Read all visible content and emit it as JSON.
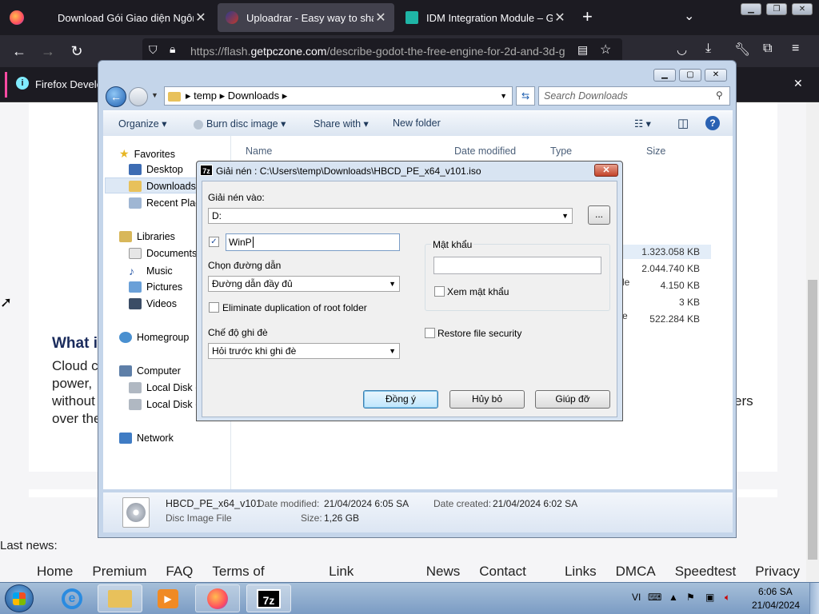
{
  "browser": {
    "tabs": [
      {
        "title": "Download Gói Giao diện Ngôn ngữ"
      },
      {
        "title": "Uploadrar - Easy way to share y"
      },
      {
        "title": "IDM Integration Module – Get th"
      }
    ],
    "new_tab": "+",
    "url_prefix": "https://flash.",
    "url_domain": "getpczone.com",
    "url_path": "/describe-godot-the-free-engine-for-2d-and-3d-g",
    "notification": "Firefox Develop"
  },
  "page": {
    "heading": "What i",
    "lines": [
      "Cloud c",
      "power,",
      "without",
      "over the"
    ],
    "right_fragment": "ers",
    "last_news": "Last news:",
    "footer_links": [
      "Home",
      "Premium",
      "FAQ",
      "Terms of service",
      "Link Checker",
      "News",
      "Contact Us",
      "Links",
      "DMCA",
      "Speedtest",
      "Privacy"
    ]
  },
  "explorer": {
    "breadcrumb": [
      "temp",
      "Downloads"
    ],
    "search_placeholder": "Search Downloads",
    "toolbar": {
      "organize": "Organize",
      "burn": "Burn disc image",
      "share": "Share with",
      "new_folder": "New folder"
    },
    "nav": {
      "favorites": "Favorites",
      "desktop": "Desktop",
      "downloads": "Downloads",
      "recent": "Recent Places",
      "libraries": "Libraries",
      "documents": "Documents",
      "music": "Music",
      "pictures": "Pictures",
      "videos": "Videos",
      "homegroup": "Homegroup",
      "computer": "Computer",
      "local_c": "Local Disk (C:)",
      "local_d": "Local Disk (D:)",
      "network": "Network"
    },
    "columns": {
      "name": "Name",
      "date": "Date modified",
      "type": "Type",
      "size": "Size"
    },
    "sizes": [
      "1.323.058 KB",
      "2.044.740 KB",
      "4.150 KB",
      "3 KB",
      "522.284 KB"
    ],
    "type_fragments": [
      "le",
      "e"
    ],
    "details": {
      "filename": "HBCD_PE_x64_v101",
      "filetype": "Disc Image File",
      "date_modified_label": "Date modified:",
      "date_modified": "21/04/2024 6:05 SA",
      "date_created_label": "Date created:",
      "date_created": "21/04/2024 6:02 SA",
      "size_label": "Size:",
      "size": "1,26 GB"
    }
  },
  "dialog": {
    "title": "Giải nén : C:\\Users\\temp\\Downloads\\HBCD_PE_x64_v101.iso",
    "icon_label": "7z",
    "extract_to_label": "Giải nén vào:",
    "extract_to_value": "D:",
    "browse": "...",
    "subfolder_value": "WinP",
    "path_mode_label": "Chọn đường dẫn",
    "path_mode_value": "Đường dẫn đầy đủ",
    "eliminate_label": "Eliminate duplication of root folder",
    "overwrite_label": "Chế độ ghi đè",
    "overwrite_value": "Hỏi trước khi ghi đè",
    "password_label": "Mật khẩu",
    "show_password_label": "Xem mật khẩu",
    "restore_label": "Restore file security",
    "ok": "Đồng ý",
    "cancel": "Hủy bỏ",
    "help": "Giúp đỡ"
  },
  "taskbar": {
    "lang": "VI",
    "time": "6:06 SA",
    "date": "21/04/2024"
  }
}
